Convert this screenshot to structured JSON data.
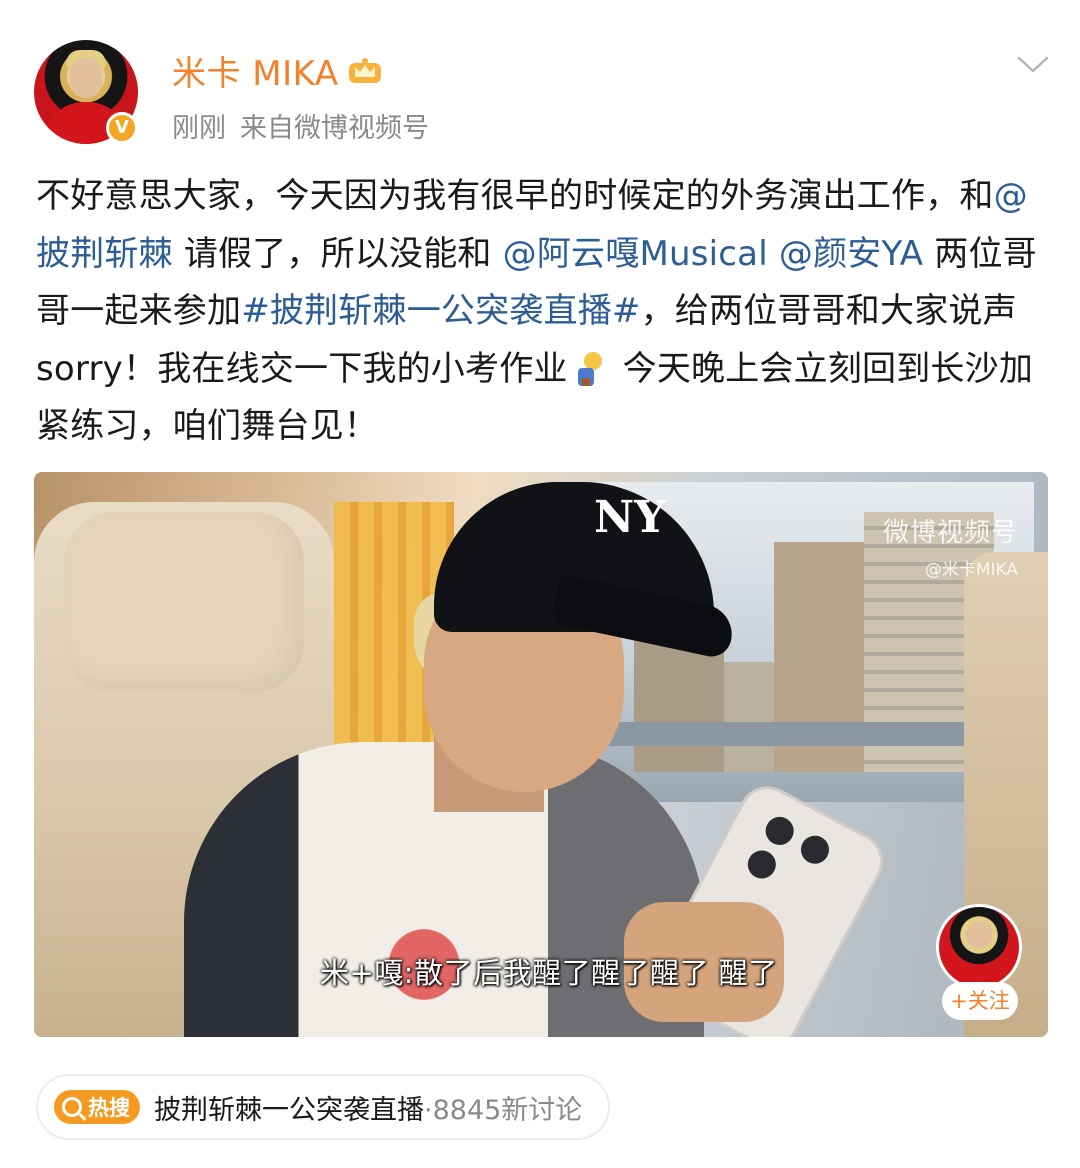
{
  "post": {
    "author": {
      "name": "米卡 MIKA",
      "verified_badge": "V",
      "badge_color": "#f5a623",
      "crown_icon": "crown-icon"
    },
    "meta": {
      "time": "刚刚",
      "source": "来自微博视频号"
    },
    "text": {
      "p1": "不好意思大家，今天因为我有很早的时候定的外务演出工作，和",
      "mention1": "@披荆斩棘",
      "p2": " 请假了，所以没能和 ",
      "mention2": "@阿云嘎Musical",
      "p3": " ",
      "mention3": "@颜安YA",
      "p4": " 两位哥哥一起来参加",
      "hashtag": "#披荆斩棘一公突袭直播#",
      "p5": "，给两位哥哥和大家说声sorry！我在线交一下我的小考作业",
      "p6": " 今天晚上会立刻回到长沙加紧练习，咱们舞台见！"
    },
    "video": {
      "watermark_line1": "微博视频号",
      "watermark_line2": "@米卡MIKA",
      "subtitle": "米+嘎:散了后我醒了醒了醒了 醒了",
      "cap_logo": "NY",
      "follow_label": "+关注"
    },
    "hot_search": {
      "badge": "热搜",
      "topic": "披荆斩棘一公突袭直播",
      "count": "·8845新讨论"
    },
    "colors": {
      "author_name": "#f4812a",
      "link": "#2d5d95",
      "meta": "#8a8a8a",
      "hot_badge": "#f59a20"
    }
  }
}
